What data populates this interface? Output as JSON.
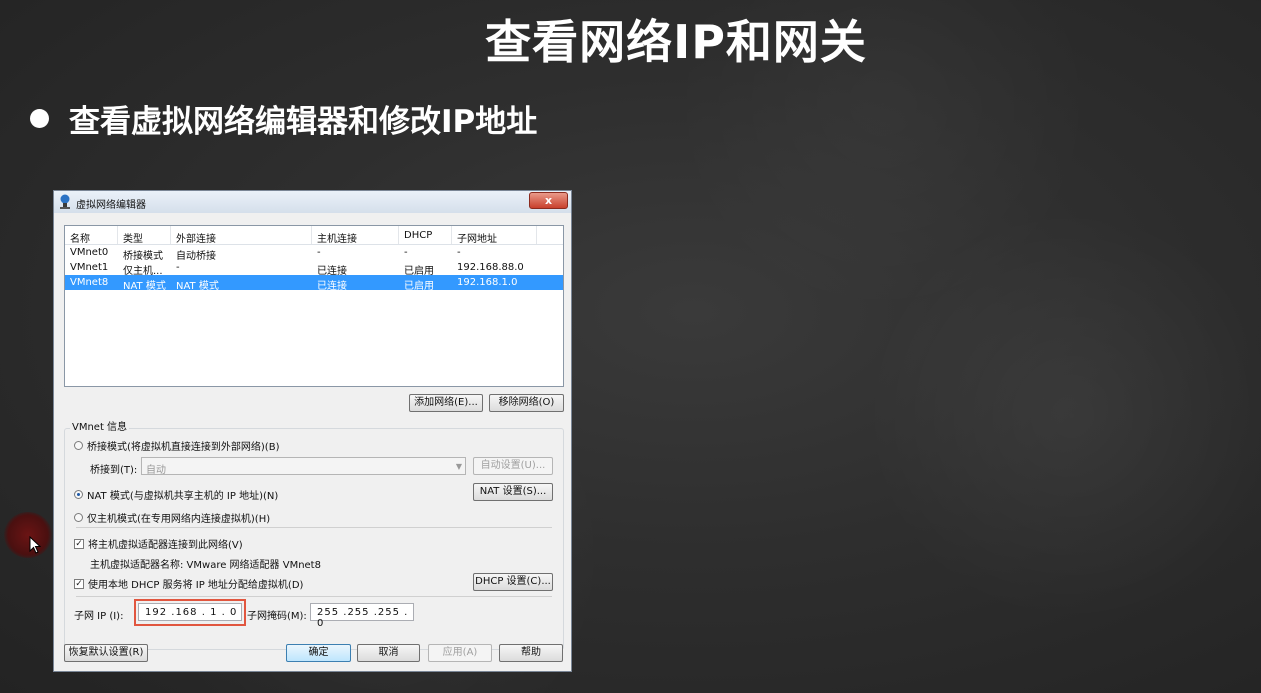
{
  "slide": {
    "title": "查看网络IP和网关",
    "bullet": "查看虚拟网络编辑器和修改IP地址"
  },
  "dialog": {
    "title": "虚拟网络编辑器",
    "close": "x",
    "columns": [
      "名称",
      "类型",
      "外部连接",
      "主机连接",
      "DHCP",
      "子网地址"
    ],
    "rows": [
      {
        "name": "VMnet0",
        "type": "桥接模式",
        "external": "自动桥接",
        "host": "-",
        "dhcp": "-",
        "subnet": "-",
        "selected": false
      },
      {
        "name": "VMnet1",
        "type": "仅主机...",
        "external": "-",
        "host": "已连接",
        "dhcp": "已启用",
        "subnet": "192.168.88.0",
        "selected": false
      },
      {
        "name": "VMnet8",
        "type": "NAT 模式",
        "external": "NAT 模式",
        "host": "已连接",
        "dhcp": "已启用",
        "subnet": "192.168.1.0",
        "selected": true
      }
    ],
    "add_network": "添加网络(E)...",
    "remove_network": "移除网络(O)",
    "vmnet_info": "VMnet 信息",
    "bridge_mode": "桥接模式(将虚拟机直接连接到外部网络)(B)",
    "bridge_to_label": "桥接到(T):",
    "bridge_to_value": "自动",
    "auto_settings": "自动设置(U)...",
    "nat_mode": "NAT 模式(与虚拟机共享主机的 IP 地址)(N)",
    "nat_settings": "NAT 设置(S)...",
    "host_only": "仅主机模式(在专用网络内连接虚拟机)(H)",
    "connect_adapter": "将主机虚拟适配器连接到此网络(V)",
    "adapter_name": "主机虚拟适配器名称: VMware 网络适配器 VMnet8",
    "use_dhcp": "使用本地 DHCP 服务将 IP 地址分配给虚拟机(D)",
    "dhcp_settings": "DHCP 设置(C)...",
    "subnet_ip_label": "子网 IP (I):",
    "subnet_ip_value": "192 .168 . 1 . 0",
    "subnet_mask_label": "子网掩码(M):",
    "subnet_mask_value": "255 .255 .255 . 0",
    "restore_defaults": "恢复默认设置(R)",
    "ok": "确定",
    "cancel": "取消",
    "apply": "应用(A)",
    "help": "帮助",
    "selected_mode": "nat",
    "connect_adapter_checked": true,
    "use_dhcp_checked": true
  },
  "colors": {
    "selection": "#3399ff",
    "highlight_box": "#e1563f"
  }
}
